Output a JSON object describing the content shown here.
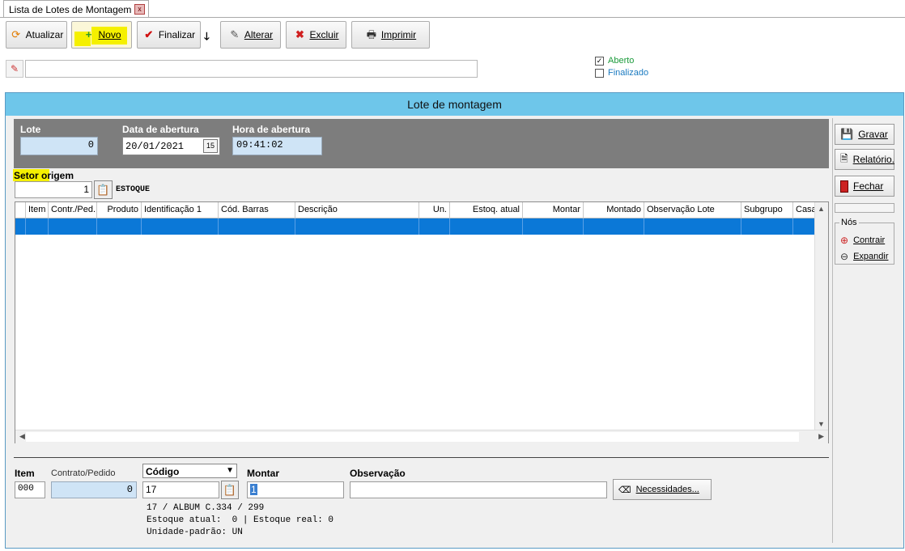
{
  "tab": {
    "title": "Lista de Lotes de Montagem",
    "close": "x"
  },
  "toolbar": {
    "atualizar": "Atualizar",
    "novo": "Novo",
    "finalizar": "Finalizar",
    "alterar": "Alterar",
    "excluir": "Excluir",
    "imprimir": "Imprimir"
  },
  "filters": {
    "aberto": "Aberto",
    "finalizado": "Finalizado",
    "aberto_checked": true,
    "finalizado_checked": false
  },
  "window": {
    "title": "Lote de montagem"
  },
  "header": {
    "lote_label": "Lote",
    "lote_value": "0",
    "data_label": "Data de abertura",
    "data_value": "20/01/2021",
    "cal_icon": "15",
    "hora_label": "Hora de abertura",
    "hora_value": "09:41:02"
  },
  "setor": {
    "label": "Setor origem",
    "value": "1",
    "name": "ESTOQUE"
  },
  "grid": {
    "columns": [
      "Item",
      "Contr./Ped.",
      "Produto",
      "Identificação 1",
      "Cód. Barras",
      "Descrição",
      "Un.",
      "Estoq. atual",
      "Montar",
      "Montado",
      "Observação Lote",
      "Subgrupo",
      "Casa"
    ]
  },
  "side": {
    "gravar": "Gravar",
    "relatorio": "Relatório.",
    "fechar": "Fechar",
    "nos_label": "Nós",
    "contrair": "Contrair",
    "expandir": "Expandir"
  },
  "bottom": {
    "item_label": "Item",
    "item_value": "000",
    "contrato_label": "Contrato/Pedido",
    "contrato_value": "0",
    "codigo_label": "Código",
    "codigo_value": "17",
    "montar_label": "Montar",
    "montar_value": "1",
    "obs_label": "Observação",
    "obs_value": "",
    "necessidades": "Necessidades...",
    "info1": "17 / ALBUM C.334 / 299",
    "info2": "Estoque atual:  0 | Estoque real: 0",
    "info3": "Unidade-padrão: UN"
  },
  "colors": {
    "title_bar": "#6ec6ea",
    "selection": "#0b78d7",
    "highlight": "#f5f000",
    "header_panel": "#7d7d7d"
  }
}
